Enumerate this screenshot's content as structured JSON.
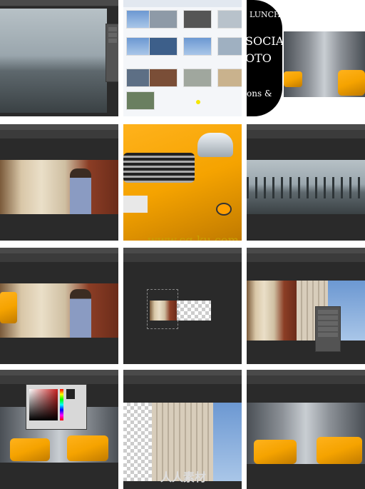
{
  "tiles": [
    {
      "name": "bridge-workspace",
      "type": "photoshop"
    },
    {
      "name": "file-browser",
      "type": "explorer"
    },
    {
      "name": "title-card",
      "type": "title"
    },
    {
      "name": "subway-workspace",
      "type": "photoshop"
    },
    {
      "name": "taxi-closeup",
      "type": "photo"
    },
    {
      "name": "bridge-railing",
      "type": "photoshop"
    },
    {
      "name": "subway-taxi-composite",
      "type": "photoshop"
    },
    {
      "name": "small-canvas-transparent",
      "type": "photoshop"
    },
    {
      "name": "subway-building-composite",
      "type": "photoshop"
    },
    {
      "name": "color-picker-street",
      "type": "photoshop"
    },
    {
      "name": "building-transparent",
      "type": "photoshop"
    },
    {
      "name": "final-taxi-street",
      "type": "photoshop"
    }
  ],
  "title_card": {
    "line1": "LUNCH™",
    "line2": "SOCIAL",
    "line3": "OTO",
    "line4": "ons &"
  },
  "watermark": {
    "url": "www.cg-ku.com",
    "brand": "人人素材"
  },
  "colors": {
    "ps_dark": "#2a2a2a",
    "taxi_yellow": "#f5a300",
    "watermark": "#c9a300"
  }
}
